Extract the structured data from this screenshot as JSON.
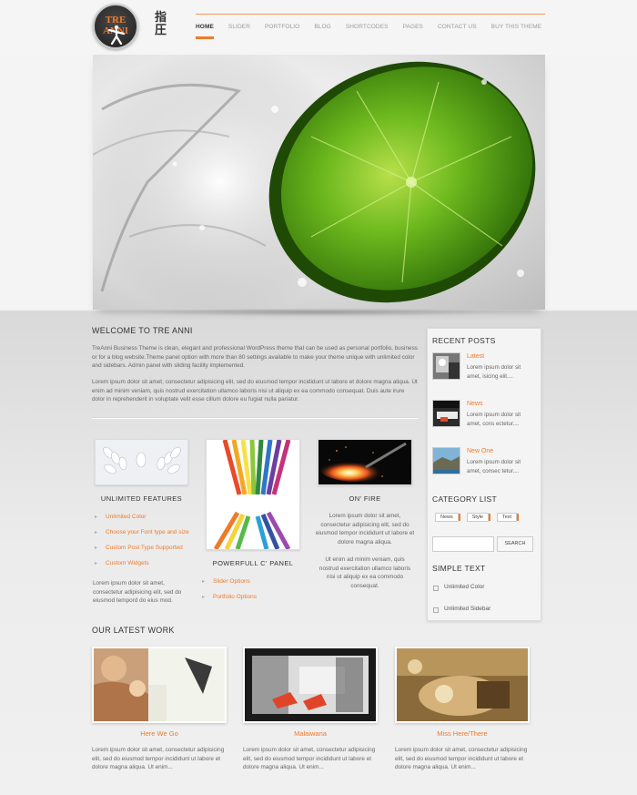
{
  "brand": {
    "logo_text": "TRE ANNI",
    "kanji": "指圧",
    "accent": "#f07a2a"
  },
  "nav": {
    "items": [
      "HOME",
      "SLIDER",
      "PORTFOLIO",
      "BLOG",
      "SHORTCODES",
      "PAGES",
      "CONTACT US",
      "BUY THIS THEME"
    ],
    "active": "HOME"
  },
  "welcome": {
    "title": "WELCOME TO TRE ANNI",
    "p1": "TreAnni Business Theme is clean, elegant and professional WordPress theme that can be used as personal portfolio, business or for a blog website.Theme panel option with more than 80 settings available to make your theme unique with unlimited color and sidebars. Admin panel with sliding facility implemented.",
    "p2": "Lorem ipsum dolor sit amet, consectetur adipisicing elit, sed do eiusmod tempor incididunt ut labore et dolore magna aliqua. Ut enim ad minim veniam, quis nostrud exercitation ullamco laboris nisi ut aliquip ex ea commodo consequat. Duis aute irure dolor in reprehenderit in voluptate velit esse cillum dolore eu fugiat nulla pariatur."
  },
  "features": [
    {
      "title": "UNLIMITED FEATURES",
      "list": [
        "Unlimited Color",
        "Choose your Font type and size",
        "Custom Post Type Supported",
        "Custom Widgets"
      ],
      "text": "Lorem ipsum dolor sit amet, consectetur adipisicing elit, sed do eiusmod tempord do eius mod."
    },
    {
      "title": "POWERFULL C' PANEL",
      "list": [
        "Slider Options",
        "Portfolio Options"
      ]
    },
    {
      "title": "ON' FIRE",
      "text1": "Lorem ipsum dolor sit amet, consectetur adipisicing elit, sed do eiusmod tempor incididunt ut labore et dolore magna aliqua.",
      "text2": "Ut enim ad minim veniam, quis nostrud exercitation ullamco laboris nisi ut aliquip ex ea commodo consequat."
    }
  ],
  "sidebar": {
    "recent_title": "RECENT POSTS",
    "posts": [
      {
        "title": "Latest",
        "text": "Lorem ipsum dolor sit amet, isicing elit...."
      },
      {
        "title": "News",
        "text": "Lorem ipsum dolor sit amet, cons ectetur...."
      },
      {
        "title": "New One",
        "text": "Lorem ipsum dolor sit amet, consec tetur...."
      }
    ],
    "category_title": "CATEGORY LIST",
    "tags": [
      "News",
      "Style",
      "Text"
    ],
    "search_button": "SEARCH",
    "search_placeholder": "",
    "simple_title": "SIMPLE TEXT",
    "simple_items": [
      "Unlimited Color",
      "Unlimited Sidebar"
    ]
  },
  "work": {
    "title": "OUR LATEST WORK",
    "items": [
      {
        "title": "Here We Go",
        "text": "Lorem ipsum dolor sit amet, consectetur adipisicing elit, sed do eiusmod tempor incididunt ut labore et dolore magna aliqua. Ut enim..."
      },
      {
        "title": "Malaiwana",
        "text": "Lorem ipsum dolor sit amet, consectetur adipisicing elit, sed do eiusmod tempor incididunt ut labore et dolore magna aliqua. Ut enim..."
      },
      {
        "title": "Miss Here/There",
        "text": "Lorem ipsum dolor sit amet, consectetur adipisicing elit, sed do eiusmod tempor incididunt ut labore et dolore magna aliqua. Ut enim..."
      }
    ]
  }
}
